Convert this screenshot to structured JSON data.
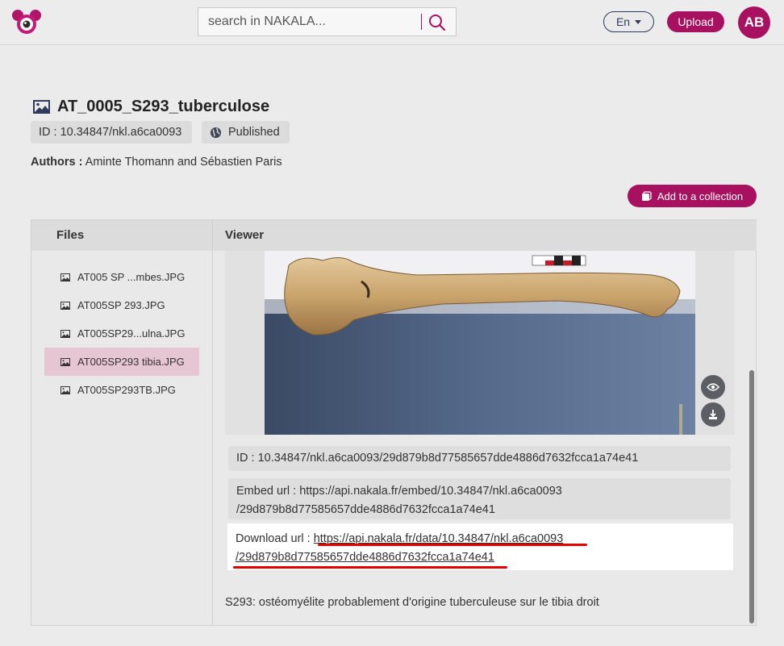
{
  "header": {
    "logo": "nakala-logo",
    "search": {
      "placeholder": "search in NAKALA...",
      "icon": "search-icon"
    },
    "language": "En",
    "upload_label": "Upload",
    "avatar_initials": "AB",
    "accent_color": "#a8115f"
  },
  "record": {
    "title_icon": "image-icon",
    "title": "AT_0005_S293_tuberculose",
    "id_badge": "ID : 10.34847/nkl.a6ca0093",
    "status_icon": "globe-icon",
    "status": "Published",
    "authors_label": "Authors :",
    "authors": "Aminte Thomann and Sébastien Paris",
    "add_collection_label": "Add to a collection"
  },
  "panel": {
    "files_title": "Files",
    "viewer_title": "Viewer",
    "files": [
      {
        "name": "AT005 SP ...mbes.JPG",
        "active": false
      },
      {
        "name": "AT005SP 293.JPG",
        "active": false
      },
      {
        "name": "AT005SP29...ulna.JPG",
        "active": false
      },
      {
        "name": "AT005SP293 tibia.JPG",
        "active": true
      },
      {
        "name": "AT005SP293TB.JPG",
        "active": false
      }
    ],
    "viewer_buttons": [
      "eye-icon",
      "download-icon"
    ],
    "file_id": "ID : 10.34847/nkl.a6ca0093/29d879b8d77585657dde4886d7632fcca1a74e41",
    "embed_label": "Embed url :",
    "embed_line1": "https://api.nakala.fr/embed/10.34847/nkl.a6ca0093",
    "embed_line2": "/29d879b8d77585657dde4886d7632fcca1a74e41",
    "download_label": "Download url :",
    "download_line1": "https://api.nakala.fr/data/10.34847/nkl.a6ca0093",
    "download_line2": "/29d879b8d77585657dde4886d7632fcca1a74e41",
    "description": "S293: ostéomyélite probablement d'origine tuberculeuse sur le tibia droit"
  }
}
